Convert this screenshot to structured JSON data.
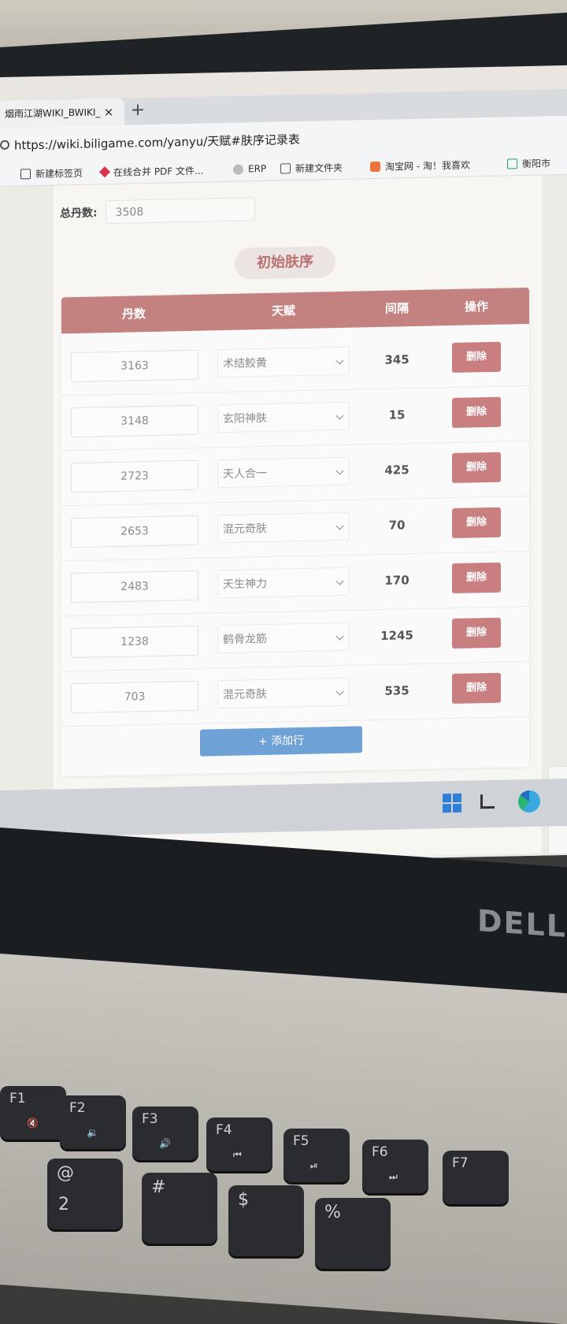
{
  "browser": {
    "tab_title": "烟雨江湖WIKI_BWIKI_",
    "tab_close": "×",
    "tab_new": "+",
    "url": "https://wiki.biligame.com/yanyu/天赋#肤序记录表",
    "bookmarks": [
      {
        "label": "新建标签页",
        "icon": "page-icon"
      },
      {
        "label": "在线合并 PDF 文件...",
        "icon": "pdf-icon"
      },
      {
        "label": "ERP",
        "icon": "erp-icon"
      },
      {
        "label": "新建文件夹",
        "icon": "folder-icon"
      },
      {
        "label": "淘宝网 - 淘！我喜欢",
        "icon": "taobao-icon"
      },
      {
        "label": "衡阳市",
        "icon": "green-icon"
      }
    ]
  },
  "page": {
    "total_label": "总丹数:",
    "total_value": "3508",
    "section_title": "初始肤序",
    "table": {
      "headers": [
        "丹数",
        "天赋",
        "间隔",
        "操作"
      ],
      "rows": [
        {
          "dan": "3163",
          "talent": "术结鲛黄",
          "gap": "345",
          "action": "删除"
        },
        {
          "dan": "3148",
          "talent": "玄阳神肤",
          "gap": "15",
          "action": "删除"
        },
        {
          "dan": "2723",
          "talent": "天人合一",
          "gap": "425",
          "action": "删除"
        },
        {
          "dan": "2653",
          "talent": "混元奇肤",
          "gap": "70",
          "action": "删除"
        },
        {
          "dan": "2483",
          "talent": "天生神力",
          "gap": "170",
          "action": "删除"
        },
        {
          "dan": "1238",
          "talent": "鹤骨龙筋",
          "gap": "1245",
          "action": "删除"
        },
        {
          "dan": "703",
          "talent": "混元奇肤",
          "gap": "535",
          "action": "删除"
        }
      ]
    },
    "add_row_label": "+ 添加行"
  },
  "taskbar": {
    "icons": [
      "windows-start-icon",
      "file-explorer-icon",
      "edge-browser-icon"
    ]
  },
  "laptop": {
    "brand": "DELL",
    "keys": [
      {
        "label": "F1",
        "sym": "🔇"
      },
      {
        "label": "F2",
        "sym": "🔉"
      },
      {
        "label": "F3",
        "sym": "🔊"
      },
      {
        "label": "F4",
        "sym": "⏮"
      },
      {
        "label": "F5",
        "sym": "⏯"
      },
      {
        "label": "F6",
        "sym": "⏭"
      },
      {
        "label": "F7",
        "sym": ""
      }
    ],
    "number_keys": [
      {
        "label": "@",
        "sym": "2"
      },
      {
        "label": "#",
        "sym": ""
      },
      {
        "label": "$",
        "sym": ""
      },
      {
        "label": "%",
        "sym": ""
      }
    ]
  },
  "colors": {
    "header_bg": "#c3827f",
    "delete_btn": "#c97f7f",
    "add_btn": "#6ea2d6",
    "section_title_text": "#b87070"
  }
}
